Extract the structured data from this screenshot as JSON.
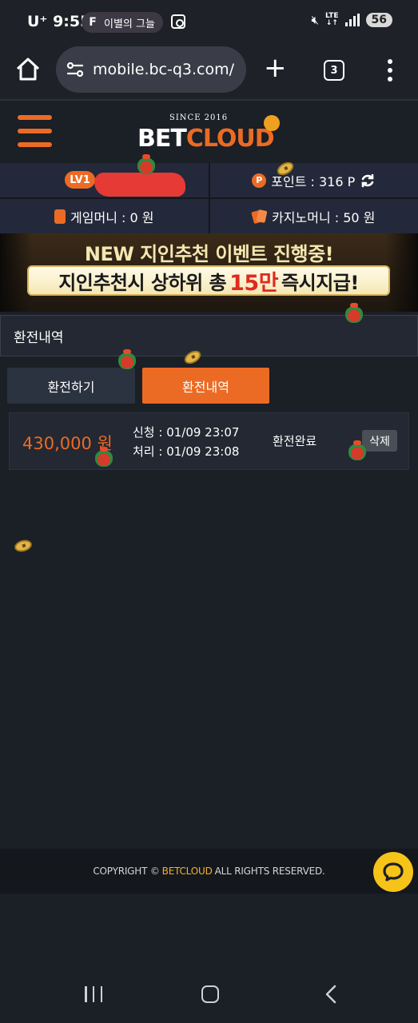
{
  "status_bar": {
    "carrier": "U⁺ 9:55",
    "notification_text": "이별의 그늘",
    "lte_top": "LTE",
    "lte_bottom": "↓↑",
    "battery": "56"
  },
  "browser": {
    "url": "mobile.bc-q3.com/",
    "tab_count": "3"
  },
  "header": {
    "logo_since": "SINCE 2016",
    "logo_bet": "BET",
    "logo_cloud": "CLOUD"
  },
  "user_info": {
    "level_badge": "LV1",
    "points_label": "포인트 : 316 P",
    "game_money_label": "게임머니 : 0 원",
    "casino_money_label": "카지노머니 : 50 원"
  },
  "banner": {
    "line1": "NEW 지인추천 이벤트 진행중!",
    "line2_prefix": "지인추천시 상하위 총",
    "line2_highlight": "15만",
    "line2_suffix": "즉시지급!"
  },
  "page": {
    "section_title": "환전내역",
    "tabs": [
      {
        "label": "환전하기",
        "active": false
      },
      {
        "label": "환전내역",
        "active": true
      }
    ]
  },
  "records": [
    {
      "amount": "430,000 원",
      "requested": "신청 : 01/09 23:07",
      "processed": "처리 : 01/09 23:08",
      "status": "환전완료",
      "delete_label": "삭제"
    }
  ],
  "footer": {
    "prefix": "COPYRIGHT ©",
    "brand": "BETCLOUD",
    "suffix": "ALL RIGHTS RESERVED."
  },
  "colors": {
    "accent": "#ec6b24",
    "background": "#1b1f26",
    "panel": "#232833",
    "footer_brand": "#f2b22c",
    "chat_button": "#f6c318"
  },
  "icons": {
    "home": "home-icon",
    "tune": "site-settings-icon",
    "new_tab": "plus-icon",
    "tabs": "tab-switcher-icon",
    "menu": "more-vert-icon",
    "hamburger": "hamburger-menu-icon",
    "point": "point-coin-icon",
    "refresh": "refresh-icon",
    "wallet": "wallet-icon",
    "cards": "playing-cards-icon",
    "chat": "chat-bubble-icon"
  }
}
